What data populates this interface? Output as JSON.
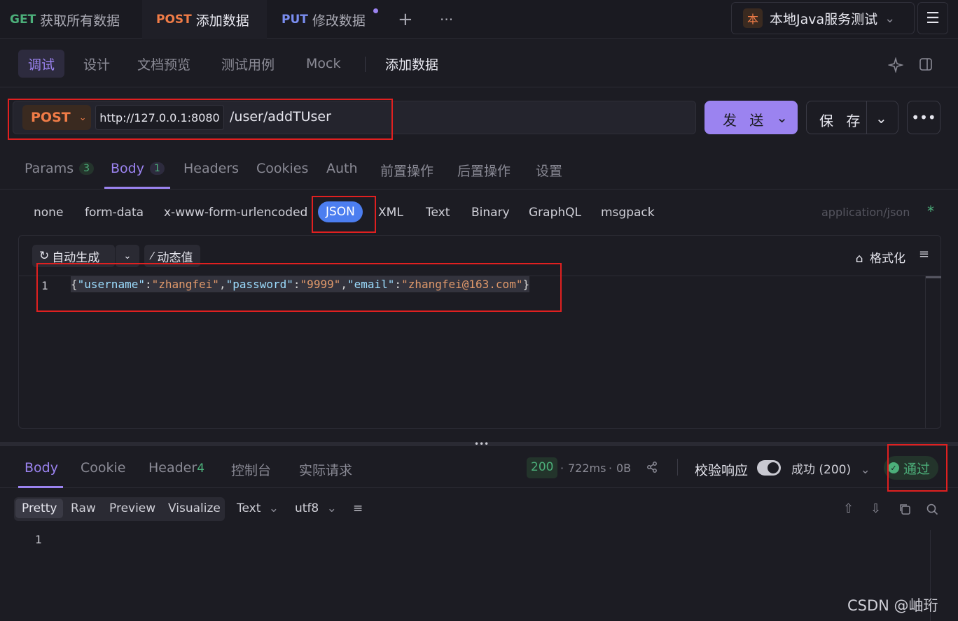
{
  "tabs": [
    {
      "method": "GET",
      "label": "获取所有数据"
    },
    {
      "method": "POST",
      "label": "添加数据"
    },
    {
      "method": "PUT",
      "label": "修改数据"
    }
  ],
  "tabbar": {
    "add": "+",
    "more": "···"
  },
  "environment": {
    "badge": "本",
    "name": "本地Java服务测试",
    "chevron": "⌄"
  },
  "menu_icon": "☰",
  "modes": [
    "调试",
    "设计",
    "文档预览",
    "测试用例",
    "Mock"
  ],
  "page_title": "添加数据",
  "request": {
    "method": "POST",
    "host": "http://127.0.0.1:8080",
    "path": "/user/addTUser",
    "send_label": "发 送",
    "save_label": "保 存"
  },
  "request_tabs": [
    {
      "label": "Params",
      "count": "3"
    },
    {
      "label": "Body",
      "count": "1"
    },
    {
      "label": "Headers",
      "count": ""
    },
    {
      "label": "Cookies",
      "count": ""
    },
    {
      "label": "Auth",
      "count": ""
    },
    {
      "label": "前置操作",
      "count": ""
    },
    {
      "label": "后置操作",
      "count": ""
    },
    {
      "label": "设置",
      "count": ""
    }
  ],
  "body_types": [
    "none",
    "form-data",
    "x-www-form-urlencoded",
    "JSON",
    "XML",
    "Text",
    "Binary",
    "GraphQL",
    "msgpack"
  ],
  "content_type": "application/json",
  "required_mark": "*",
  "editor": {
    "auto_generate": "自动生成",
    "dynamic_value": "动态值",
    "format": "格式化",
    "line_number": "1",
    "code": {
      "k1": "\"username\"",
      "v1": "\"zhangfei\"",
      "k2": "\"password\"",
      "v2": "\"9999\"",
      "k3": "\"email\"",
      "v3": "\"zhangfei@163.com\""
    }
  },
  "response": {
    "tabs": [
      {
        "label": "Body",
        "count": ""
      },
      {
        "label": "Cookie",
        "count": ""
      },
      {
        "label": "Header",
        "count": "4"
      },
      {
        "label": "控制台",
        "count": ""
      },
      {
        "label": "实际请求",
        "count": ""
      }
    ],
    "status_code": "200",
    "time": "722ms",
    "size": "0B",
    "validate_label": "校验响应",
    "result": "成功 (200)",
    "pass_label": "通过",
    "views": [
      "Pretty",
      "Raw",
      "Preview",
      "Visualize"
    ],
    "format": "Text",
    "encoding": "utf8",
    "line_number": "1"
  },
  "watermark": "CSDN @岫珩",
  "colors": {
    "accent": "#9b83f0",
    "post": "#f07c47",
    "get": "#4caf7a",
    "put": "#7a8df0",
    "highlight_box": "#e02020"
  }
}
